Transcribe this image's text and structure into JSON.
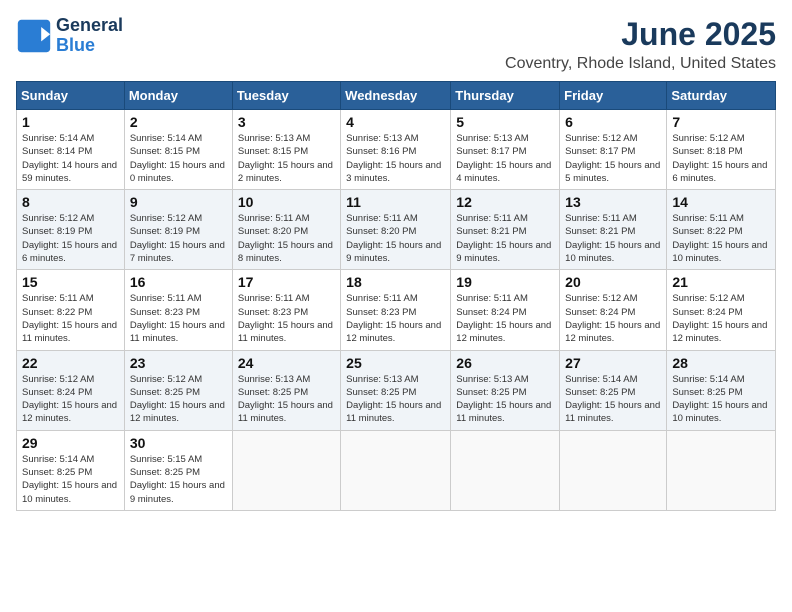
{
  "header": {
    "logo_line1": "General",
    "logo_line2": "Blue",
    "month_year": "June 2025",
    "location": "Coventry, Rhode Island, United States"
  },
  "weekdays": [
    "Sunday",
    "Monday",
    "Tuesday",
    "Wednesday",
    "Thursday",
    "Friday",
    "Saturday"
  ],
  "weeks": [
    [
      {
        "day": "1",
        "sunrise": "Sunrise: 5:14 AM",
        "sunset": "Sunset: 8:14 PM",
        "daylight": "Daylight: 14 hours and 59 minutes."
      },
      {
        "day": "2",
        "sunrise": "Sunrise: 5:14 AM",
        "sunset": "Sunset: 8:15 PM",
        "daylight": "Daylight: 15 hours and 0 minutes."
      },
      {
        "day": "3",
        "sunrise": "Sunrise: 5:13 AM",
        "sunset": "Sunset: 8:15 PM",
        "daylight": "Daylight: 15 hours and 2 minutes."
      },
      {
        "day": "4",
        "sunrise": "Sunrise: 5:13 AM",
        "sunset": "Sunset: 8:16 PM",
        "daylight": "Daylight: 15 hours and 3 minutes."
      },
      {
        "day": "5",
        "sunrise": "Sunrise: 5:13 AM",
        "sunset": "Sunset: 8:17 PM",
        "daylight": "Daylight: 15 hours and 4 minutes."
      },
      {
        "day": "6",
        "sunrise": "Sunrise: 5:12 AM",
        "sunset": "Sunset: 8:17 PM",
        "daylight": "Daylight: 15 hours and 5 minutes."
      },
      {
        "day": "7",
        "sunrise": "Sunrise: 5:12 AM",
        "sunset": "Sunset: 8:18 PM",
        "daylight": "Daylight: 15 hours and 6 minutes."
      }
    ],
    [
      {
        "day": "8",
        "sunrise": "Sunrise: 5:12 AM",
        "sunset": "Sunset: 8:19 PM",
        "daylight": "Daylight: 15 hours and 6 minutes."
      },
      {
        "day": "9",
        "sunrise": "Sunrise: 5:12 AM",
        "sunset": "Sunset: 8:19 PM",
        "daylight": "Daylight: 15 hours and 7 minutes."
      },
      {
        "day": "10",
        "sunrise": "Sunrise: 5:11 AM",
        "sunset": "Sunset: 8:20 PM",
        "daylight": "Daylight: 15 hours and 8 minutes."
      },
      {
        "day": "11",
        "sunrise": "Sunrise: 5:11 AM",
        "sunset": "Sunset: 8:20 PM",
        "daylight": "Daylight: 15 hours and 9 minutes."
      },
      {
        "day": "12",
        "sunrise": "Sunrise: 5:11 AM",
        "sunset": "Sunset: 8:21 PM",
        "daylight": "Daylight: 15 hours and 9 minutes."
      },
      {
        "day": "13",
        "sunrise": "Sunrise: 5:11 AM",
        "sunset": "Sunset: 8:21 PM",
        "daylight": "Daylight: 15 hours and 10 minutes."
      },
      {
        "day": "14",
        "sunrise": "Sunrise: 5:11 AM",
        "sunset": "Sunset: 8:22 PM",
        "daylight": "Daylight: 15 hours and 10 minutes."
      }
    ],
    [
      {
        "day": "15",
        "sunrise": "Sunrise: 5:11 AM",
        "sunset": "Sunset: 8:22 PM",
        "daylight": "Daylight: 15 hours and 11 minutes."
      },
      {
        "day": "16",
        "sunrise": "Sunrise: 5:11 AM",
        "sunset": "Sunset: 8:23 PM",
        "daylight": "Daylight: 15 hours and 11 minutes."
      },
      {
        "day": "17",
        "sunrise": "Sunrise: 5:11 AM",
        "sunset": "Sunset: 8:23 PM",
        "daylight": "Daylight: 15 hours and 11 minutes."
      },
      {
        "day": "18",
        "sunrise": "Sunrise: 5:11 AM",
        "sunset": "Sunset: 8:23 PM",
        "daylight": "Daylight: 15 hours and 12 minutes."
      },
      {
        "day": "19",
        "sunrise": "Sunrise: 5:11 AM",
        "sunset": "Sunset: 8:24 PM",
        "daylight": "Daylight: 15 hours and 12 minutes."
      },
      {
        "day": "20",
        "sunrise": "Sunrise: 5:12 AM",
        "sunset": "Sunset: 8:24 PM",
        "daylight": "Daylight: 15 hours and 12 minutes."
      },
      {
        "day": "21",
        "sunrise": "Sunrise: 5:12 AM",
        "sunset": "Sunset: 8:24 PM",
        "daylight": "Daylight: 15 hours and 12 minutes."
      }
    ],
    [
      {
        "day": "22",
        "sunrise": "Sunrise: 5:12 AM",
        "sunset": "Sunset: 8:24 PM",
        "daylight": "Daylight: 15 hours and 12 minutes."
      },
      {
        "day": "23",
        "sunrise": "Sunrise: 5:12 AM",
        "sunset": "Sunset: 8:25 PM",
        "daylight": "Daylight: 15 hours and 12 minutes."
      },
      {
        "day": "24",
        "sunrise": "Sunrise: 5:13 AM",
        "sunset": "Sunset: 8:25 PM",
        "daylight": "Daylight: 15 hours and 11 minutes."
      },
      {
        "day": "25",
        "sunrise": "Sunrise: 5:13 AM",
        "sunset": "Sunset: 8:25 PM",
        "daylight": "Daylight: 15 hours and 11 minutes."
      },
      {
        "day": "26",
        "sunrise": "Sunrise: 5:13 AM",
        "sunset": "Sunset: 8:25 PM",
        "daylight": "Daylight: 15 hours and 11 minutes."
      },
      {
        "day": "27",
        "sunrise": "Sunrise: 5:14 AM",
        "sunset": "Sunset: 8:25 PM",
        "daylight": "Daylight: 15 hours and 11 minutes."
      },
      {
        "day": "28",
        "sunrise": "Sunrise: 5:14 AM",
        "sunset": "Sunset: 8:25 PM",
        "daylight": "Daylight: 15 hours and 10 minutes."
      }
    ],
    [
      {
        "day": "29",
        "sunrise": "Sunrise: 5:14 AM",
        "sunset": "Sunset: 8:25 PM",
        "daylight": "Daylight: 15 hours and 10 minutes."
      },
      {
        "day": "30",
        "sunrise": "Sunrise: 5:15 AM",
        "sunset": "Sunset: 8:25 PM",
        "daylight": "Daylight: 15 hours and 9 minutes."
      },
      null,
      null,
      null,
      null,
      null
    ]
  ]
}
